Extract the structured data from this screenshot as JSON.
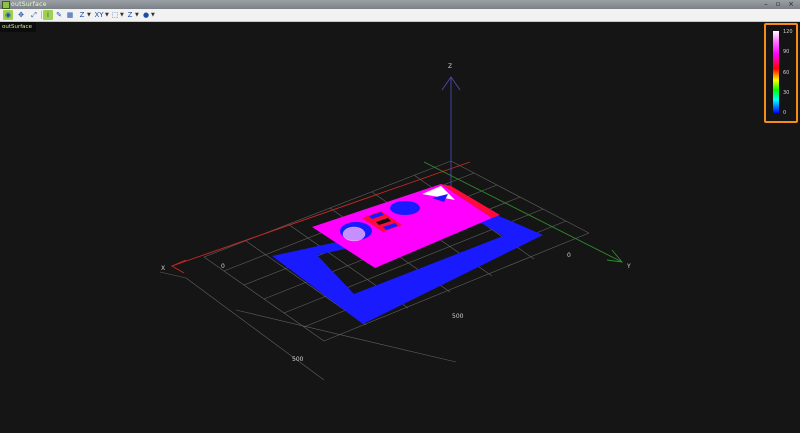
{
  "window": {
    "title": "outSurface",
    "min_label": "–",
    "max_label": "▫",
    "close_label": "×"
  },
  "toolbar": {
    "items": [
      {
        "name": "rotate-view-button",
        "glyph": "◉"
      },
      {
        "name": "pan-view-button",
        "glyph": "✥"
      },
      {
        "name": "zoom-view-button",
        "glyph": "⤢"
      },
      {
        "name": "info-button",
        "glyph": "i"
      },
      {
        "name": "pick-button",
        "glyph": "✎"
      },
      {
        "name": "render-mode-button",
        "glyph": "▦"
      },
      {
        "name": "z-scale-button",
        "glyph": "Z"
      },
      {
        "name": "xy-projection-button",
        "glyph": "XY"
      },
      {
        "name": "cube-view-button",
        "glyph": "⬚"
      },
      {
        "name": "z-axis-button",
        "glyph": "Z"
      },
      {
        "name": "point-style-button",
        "glyph": "●"
      }
    ]
  },
  "view_tab": {
    "label": "outSurface"
  },
  "axes": {
    "x": "X",
    "y": "Y",
    "z": "Z",
    "origin_left": "0",
    "origin_right": "0",
    "tick_500_a": "500",
    "tick_500_b": "500"
  },
  "legend": {
    "ticks": [
      "120",
      "90",
      "60",
      "30",
      "0"
    ]
  },
  "colors": {
    "magenta": "#ff00ff",
    "blue": "#1a1aff",
    "red": "#ff0a3a",
    "white": "#ffffff"
  }
}
